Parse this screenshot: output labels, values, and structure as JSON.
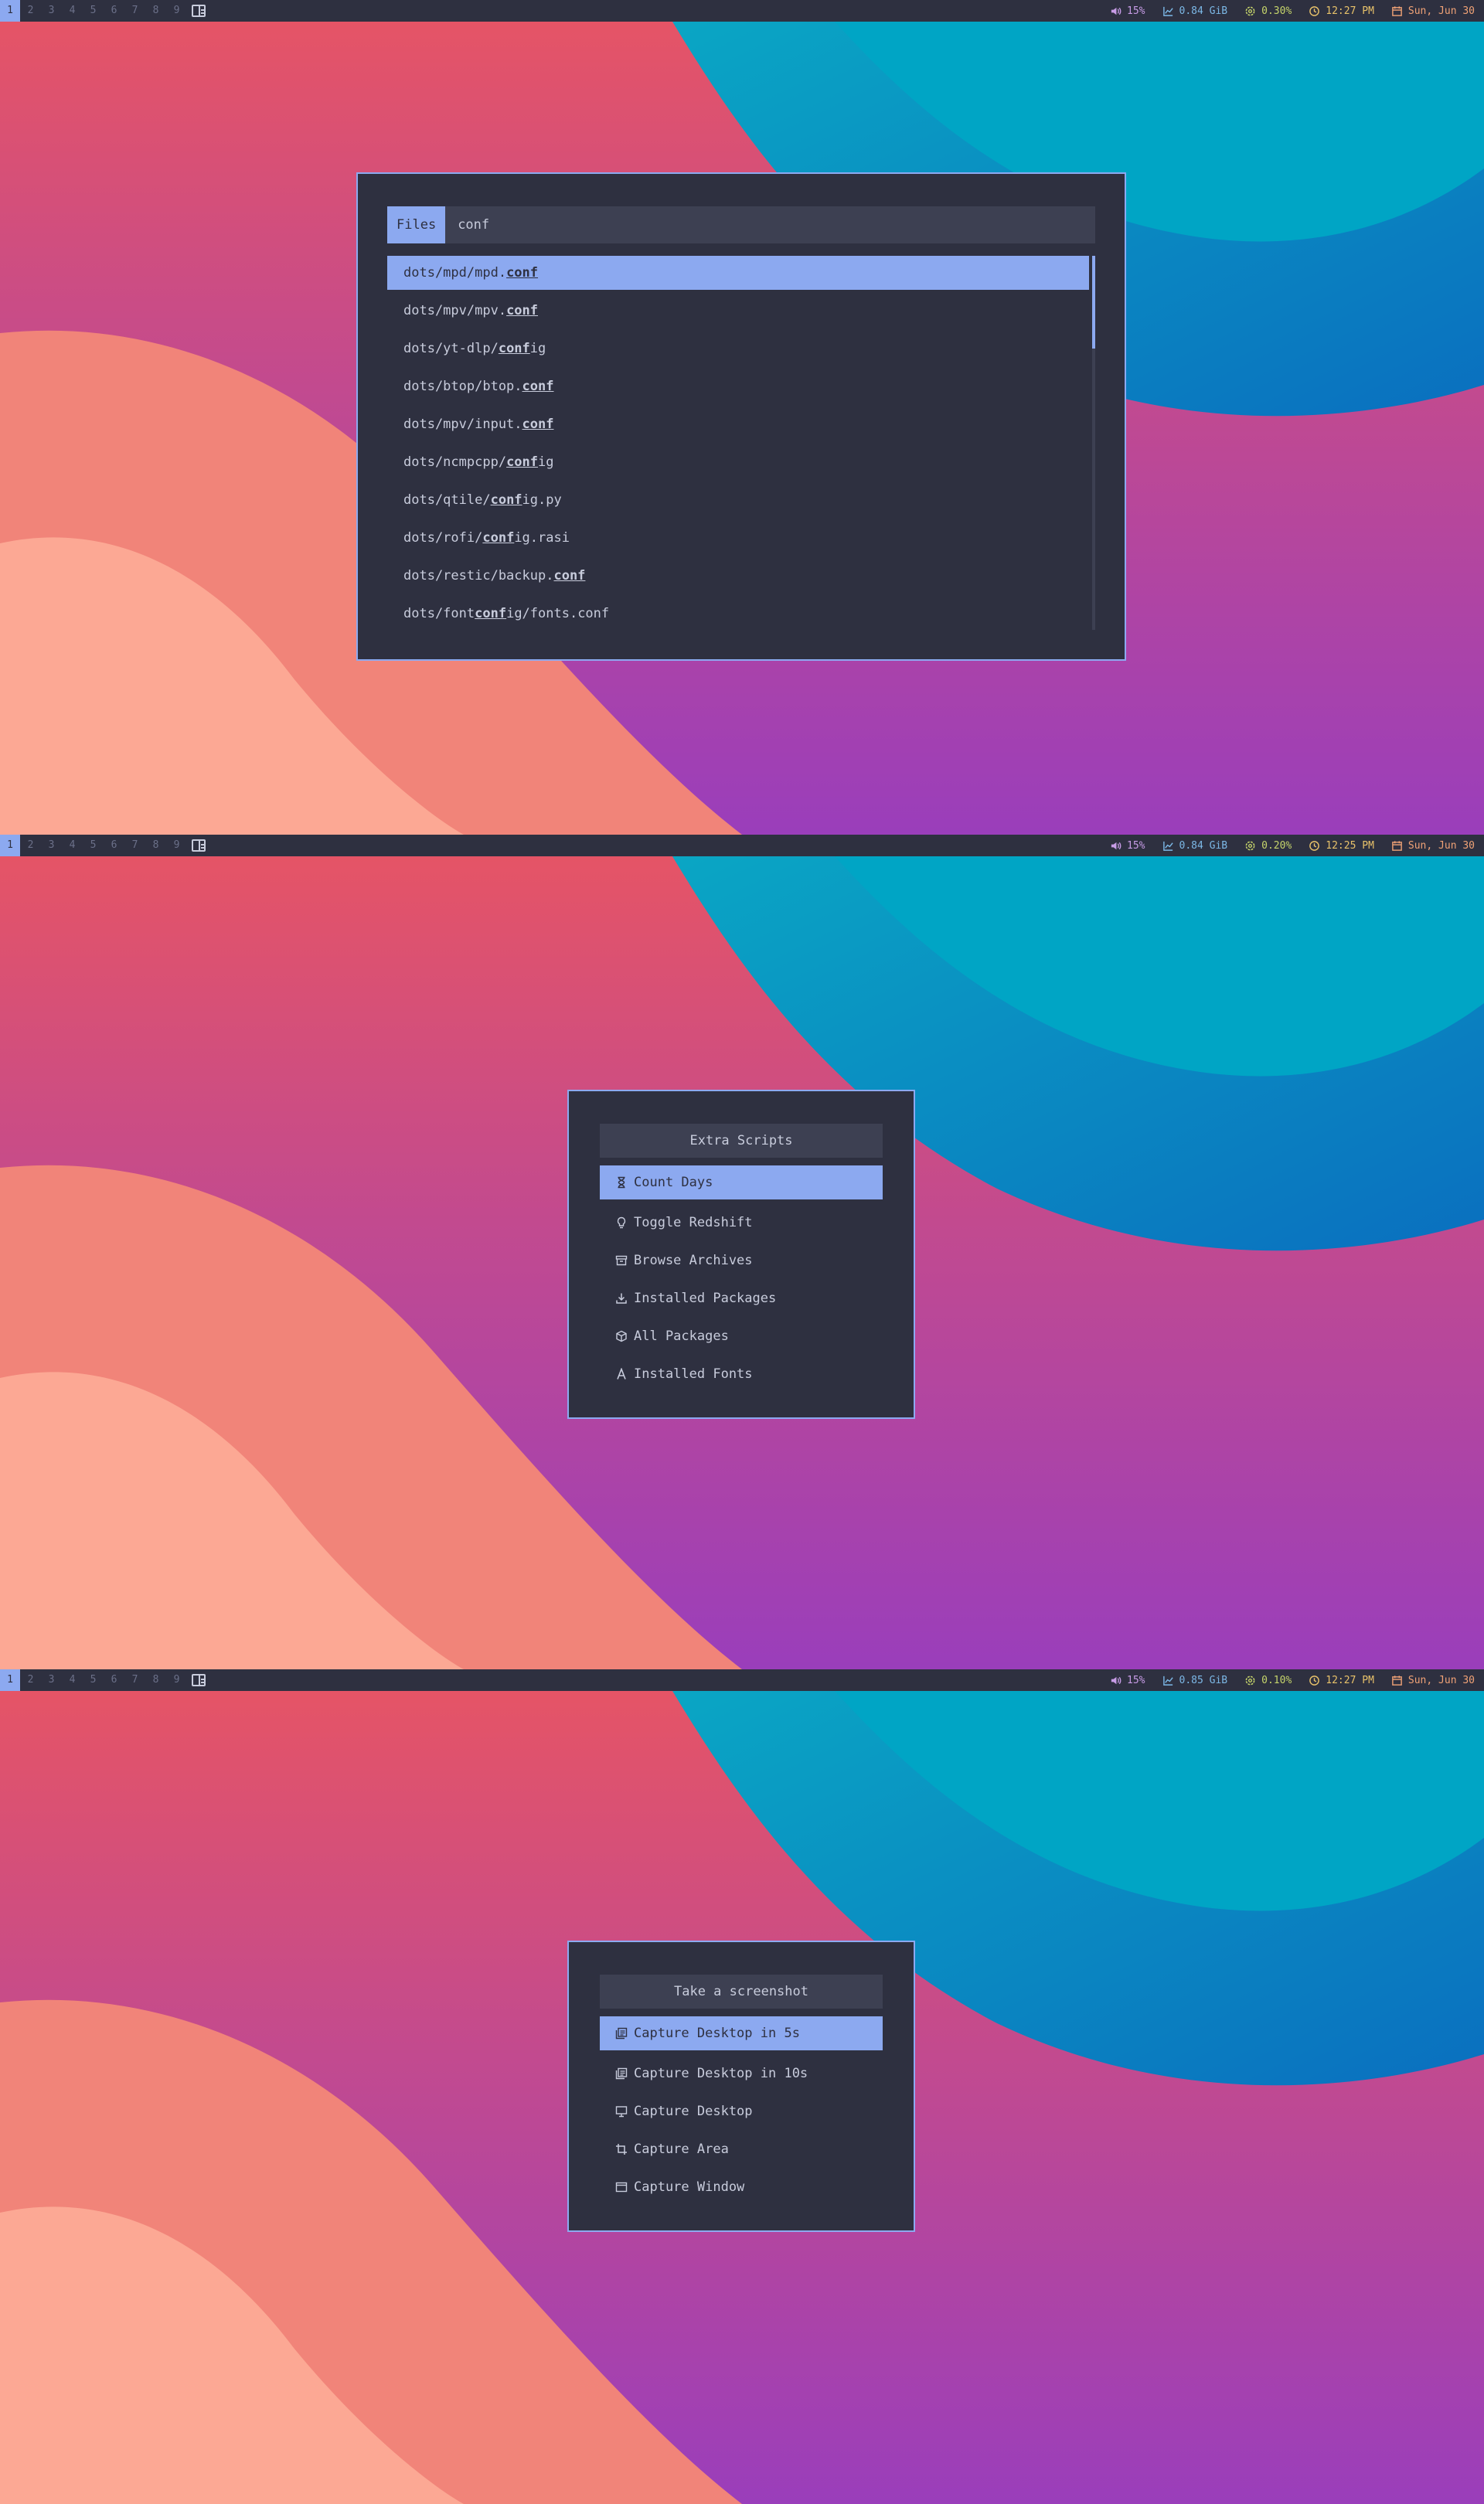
{
  "colors": {
    "bar_bg": "#2e3040",
    "accent": "#8ca9f0",
    "panel_bg": "#2e3040",
    "input_bg": "#3d4052",
    "text": "#c8ccdc",
    "volume": "#c79ce6",
    "memory": "#7cb8e6",
    "cpu": "#c5d46b",
    "clock": "#e8c26a",
    "date": "#f0a276"
  },
  "screens": [
    {
      "bar": {
        "workspaces": [
          "1",
          "2",
          "3",
          "4",
          "5",
          "6",
          "7",
          "8",
          "9"
        ],
        "active_workspace": "1",
        "layout_icon": "columns-layout-icon",
        "volume": "15%",
        "memory": "0.84 GiB",
        "cpu": "0.30%",
        "time": "12:27 PM",
        "date": "Sun, Jun 30"
      },
      "finder": {
        "prompt": "Files",
        "query": "conf",
        "items": [
          {
            "pre": "dots/mpd/mpd.",
            "match": "conf",
            "post": ""
          },
          {
            "pre": "dots/mpv/mpv.",
            "match": "conf",
            "post": ""
          },
          {
            "pre": "dots/yt-dlp/",
            "match": "conf",
            "post": "ig"
          },
          {
            "pre": "dots/btop/btop.",
            "match": "conf",
            "post": ""
          },
          {
            "pre": "dots/mpv/input.",
            "match": "conf",
            "post": ""
          },
          {
            "pre": "dots/ncmpcpp/",
            "match": "conf",
            "post": "ig"
          },
          {
            "pre": "dots/qtile/",
            "match": "conf",
            "post": "ig.py"
          },
          {
            "pre": "dots/rofi/",
            "match": "conf",
            "post": "ig.rasi"
          },
          {
            "pre": "dots/restic/backup.",
            "match": "conf",
            "post": ""
          },
          {
            "pre": "dots/font",
            "match": "conf",
            "post": "ig/fonts.conf"
          }
        ]
      }
    },
    {
      "bar": {
        "workspaces": [
          "1",
          "2",
          "3",
          "4",
          "5",
          "6",
          "7",
          "8",
          "9"
        ],
        "active_workspace": "1",
        "layout_icon": "columns-layout-icon",
        "volume": "15%",
        "memory": "0.84 GiB",
        "cpu": "0.20%",
        "time": "12:25 PM",
        "date": "Sun, Jun 30"
      },
      "menu": {
        "title": "Extra Scripts",
        "items": [
          {
            "label": "Count Days",
            "icon": "hourglass-icon"
          },
          {
            "label": "Toggle Redshift",
            "icon": "lightbulb-icon"
          },
          {
            "label": "Browse Archives",
            "icon": "archive-icon"
          },
          {
            "label": "Installed Packages",
            "icon": "download-icon"
          },
          {
            "label": "All Packages",
            "icon": "package-icon"
          },
          {
            "label": "Installed Fonts",
            "icon": "font-icon"
          }
        ]
      }
    },
    {
      "bar": {
        "workspaces": [
          "1",
          "2",
          "3",
          "4",
          "5",
          "6",
          "7",
          "8",
          "9"
        ],
        "active_workspace": "1",
        "layout_icon": "columns-layout-icon",
        "volume": "15%",
        "memory": "0.85 GiB",
        "cpu": "0.10%",
        "time": "12:27 PM",
        "date": "Sun, Jun 30"
      },
      "menu": {
        "title": "Take a screenshot",
        "items": [
          {
            "label": "Capture Desktop in 5s",
            "icon": "timer-screenshot-icon"
          },
          {
            "label": "Capture Desktop in 10s",
            "icon": "timer-screenshot-icon"
          },
          {
            "label": "Capture Desktop",
            "icon": "monitor-icon"
          },
          {
            "label": "Capture Area",
            "icon": "crop-icon"
          },
          {
            "label": "Capture Window",
            "icon": "window-icon"
          }
        ]
      }
    }
  ]
}
